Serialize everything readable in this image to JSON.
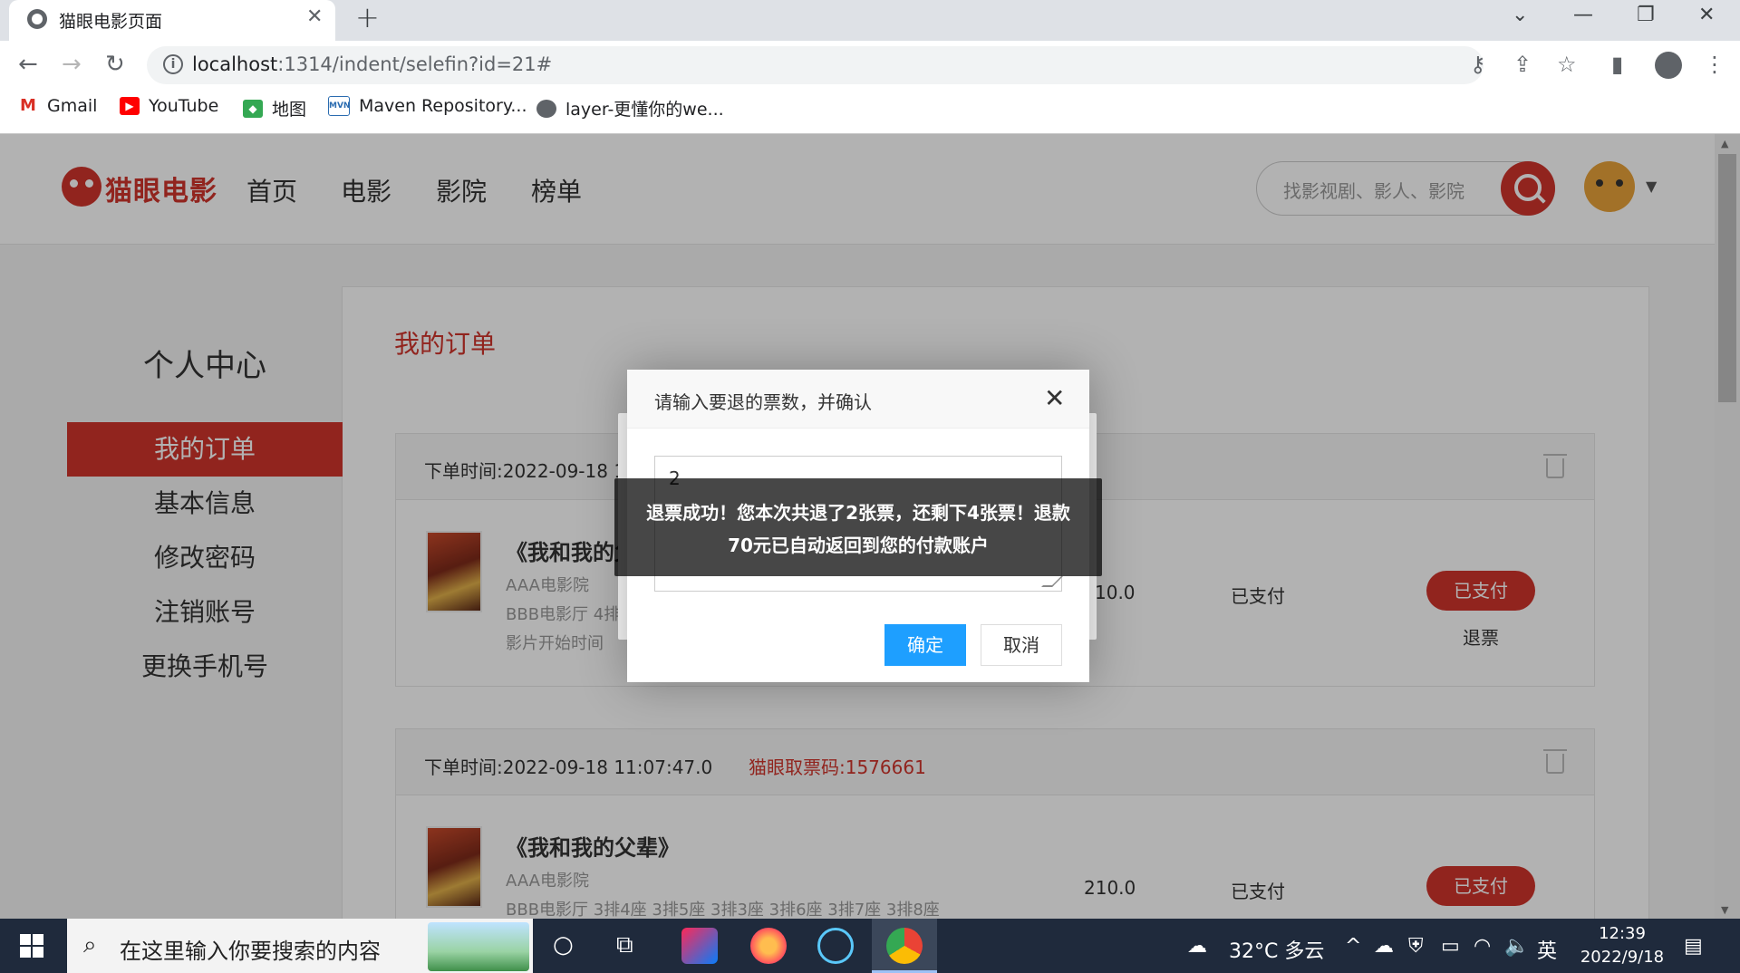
{
  "browser": {
    "tab_title": "猫眼电影页面",
    "url_host": "localhost",
    "url_rest": ":1314/indent/selefin?id=21#",
    "bookmarks": [
      "Gmail",
      "YouTube",
      "地图",
      "Maven Repository...",
      "layer-更懂你的we..."
    ]
  },
  "site": {
    "logo": "猫眼电影",
    "nav": [
      "首页",
      "电影",
      "影院",
      "榜单"
    ],
    "search_placeholder": "找影视剧、影人、影院",
    "sidebar_title": "个人中心",
    "sidebar_items": [
      "我的订单",
      "基本信息",
      "修改密码",
      "注销账号",
      "更换手机号"
    ],
    "orders_title": "我的订单",
    "orders": [
      {
        "time": "下单时间:2022-09-18 1",
        "movie": "《我和我的父",
        "cinema": "AAA电影院",
        "seats": "BBB电影厅  4排",
        "start": "影片开始时间",
        "price": "10.0",
        "status": "已支付",
        "button": "已支付",
        "refund": "退票"
      },
      {
        "time": "下单时间:2022-09-18 11:07:47.0",
        "code": "猫眼取票码:1576661",
        "movie": "《我和我的父辈》",
        "cinema": "AAA电影院",
        "seats": "BBB电影厅   3排4座   3排5座   3排3座   3排6座   3排7座   3排8座",
        "price": "210.0",
        "status": "已支付",
        "button": "已支付"
      }
    ]
  },
  "dialog": {
    "title": "请输入要退的票数，并确认",
    "input_value": "2",
    "ok": "确定",
    "cancel": "取消"
  },
  "toast": {
    "message": "退票成功！您本次共退了2张票，还剩下4张票！退款70元已自动返回到您的付款账户"
  },
  "taskbar": {
    "search_text": "在这里输入你要搜索的内容",
    "weather": "32°C  多云",
    "ime": "英",
    "time": "12:39",
    "date": "2022/9/18"
  },
  "colors": {
    "brand": "#d0342c",
    "primary_btn": "#1e9fff"
  }
}
